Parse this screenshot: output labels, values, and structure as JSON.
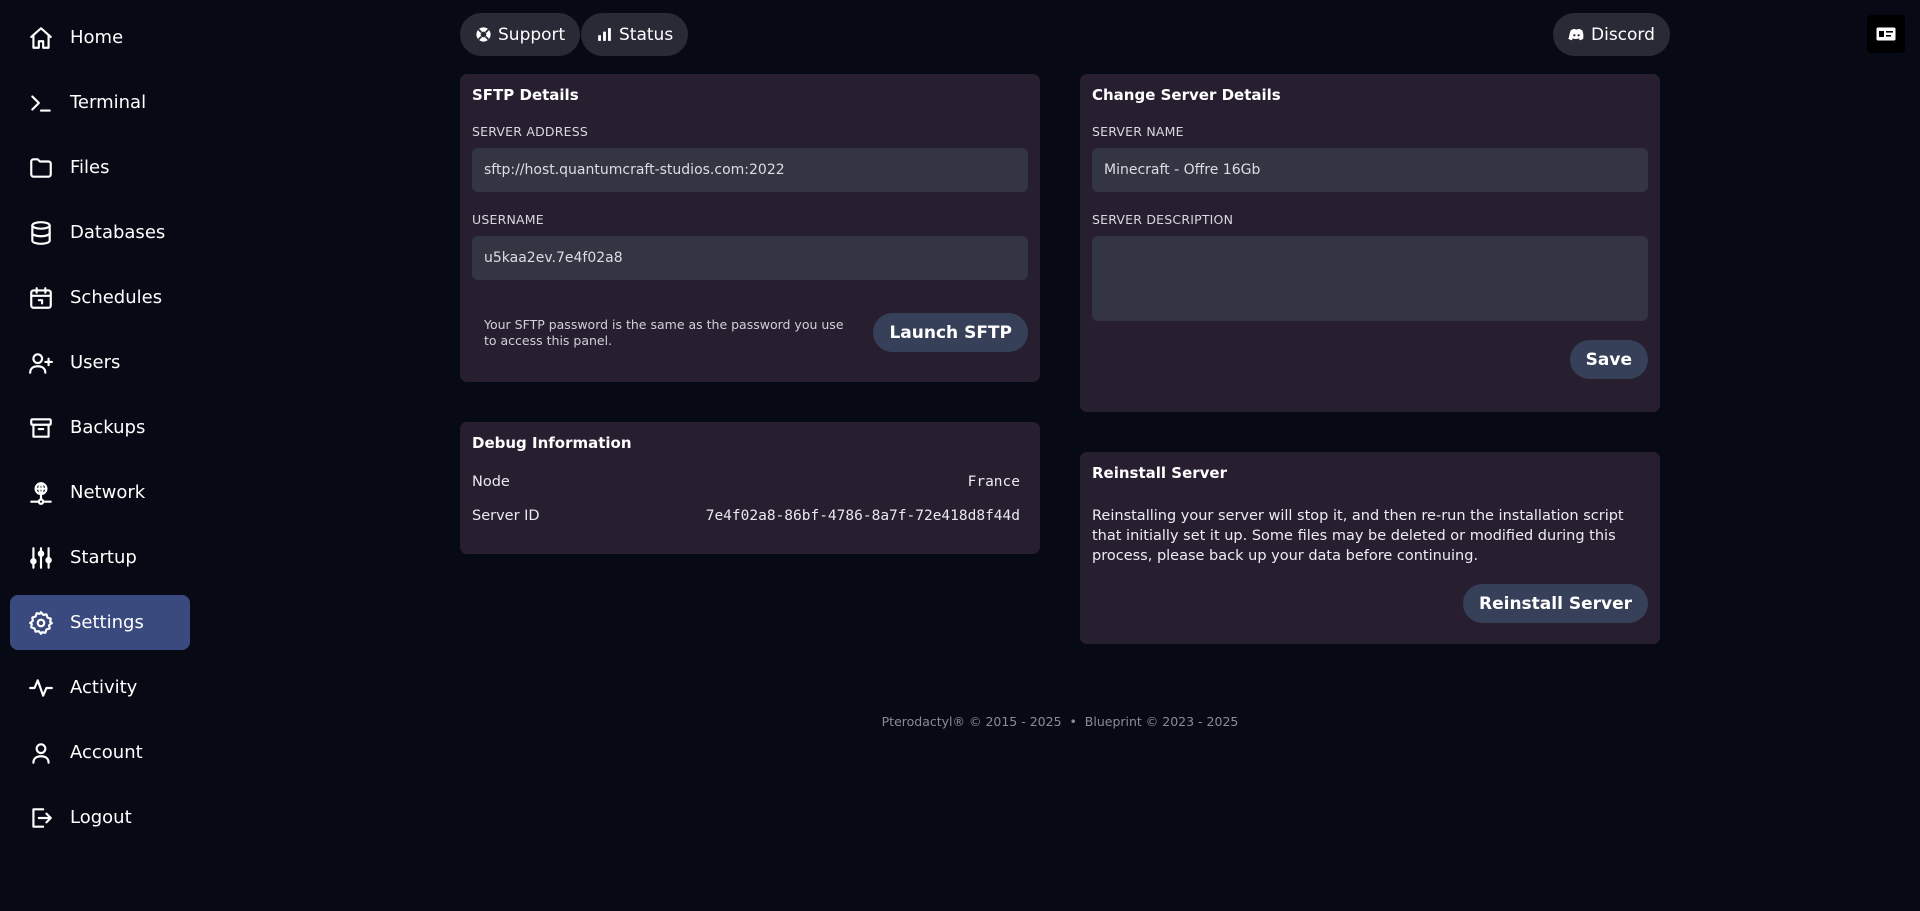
{
  "sidebar": {
    "items": [
      {
        "label": "Home"
      },
      {
        "label": "Terminal"
      },
      {
        "label": "Files"
      },
      {
        "label": "Databases"
      },
      {
        "label": "Schedules"
      },
      {
        "label": "Users"
      },
      {
        "label": "Backups"
      },
      {
        "label": "Network"
      },
      {
        "label": "Startup"
      },
      {
        "label": "Settings",
        "active": true
      },
      {
        "label": "Activity"
      },
      {
        "label": "Account"
      },
      {
        "label": "Logout"
      }
    ]
  },
  "topbar": {
    "support_label": "Support",
    "status_label": "Status",
    "discord_label": "Discord"
  },
  "sftp": {
    "title": "SFTP Details",
    "address_label": "SERVER ADDRESS",
    "address_value": "sftp://host.quantumcraft-studios.com:2022",
    "username_label": "USERNAME",
    "username_value": "u5kaa2ev.7e4f02a8",
    "note": "Your SFTP password is the same as the password you use to access this panel.",
    "launch_label": "Launch SFTP"
  },
  "debug": {
    "title": "Debug Information",
    "node_label": "Node",
    "node_value": "France",
    "server_id_label": "Server ID",
    "server_id_value": "7e4f02a8-86bf-4786-8a7f-72e418d8f44d"
  },
  "change_details": {
    "title": "Change Server Details",
    "name_label": "SERVER NAME",
    "name_value": "Minecraft - Offre 16Gb",
    "description_label": "SERVER DESCRIPTION",
    "description_value": "",
    "save_label": "Save"
  },
  "reinstall": {
    "title": "Reinstall Server",
    "text": "Reinstalling your server will stop it, and then re-run the installation script that initially set it up. Some files may be deleted or modified during this process, please back up your data before continuing.",
    "button_label": "Reinstall Server"
  },
  "footer": {
    "text": "Pterodactyl® © 2015 - 2025  •  Blueprint © 2023 - 2025"
  },
  "colors": {
    "background": "#070a14",
    "card": "#271f30",
    "active_nav": "#3b4a7e",
    "button": "#374059"
  }
}
